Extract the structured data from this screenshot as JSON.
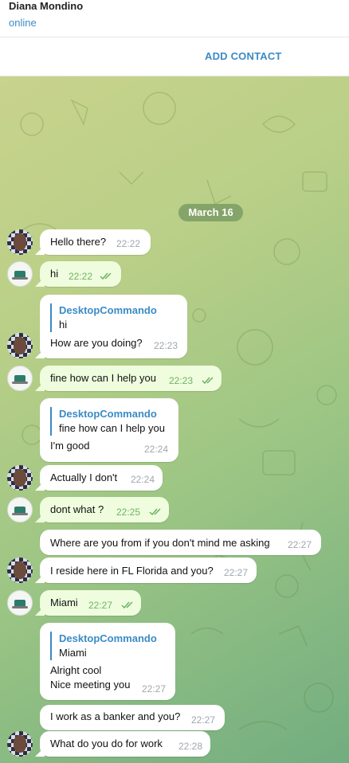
{
  "header": {
    "name": "Diana Mondino",
    "status": "online"
  },
  "add_contact": "ADD CONTACT",
  "date_pill": "March 16",
  "messages": {
    "m1": {
      "text": "Hello there?",
      "time": "22:22"
    },
    "m2": {
      "text": "hi",
      "time": "22:22"
    },
    "m3": {
      "reply_name": "DesktopCommando",
      "reply_text": "hi",
      "text": "How are you doing?",
      "time": "22:23"
    },
    "m4": {
      "text": "fine how can I help you",
      "time": "22:23"
    },
    "m5": {
      "reply_name": "DesktopCommando",
      "reply_text": "fine how can I help you",
      "text": "I'm good",
      "time": "22:24"
    },
    "m6": {
      "text": "Actually I don't",
      "time": "22:24"
    },
    "m7": {
      "text": "dont what ?",
      "time": "22:25"
    },
    "m8": {
      "text": "Where are you from if you don't mind me asking",
      "time": "22:27"
    },
    "m9": {
      "text": "I reside here in FL Florida and you?",
      "time": "22:27"
    },
    "m10": {
      "text": "Miami",
      "time": "22:27"
    },
    "m11": {
      "reply_name": "DesktopCommando",
      "reply_text": "Miami",
      "text1": "Alright cool",
      "text2": "Nice meeting you",
      "time": "22:27"
    },
    "m12": {
      "text": "I work as a banker and you?",
      "time": "22:27"
    },
    "m13": {
      "text": "What do you do for work",
      "time": "22:28"
    }
  }
}
